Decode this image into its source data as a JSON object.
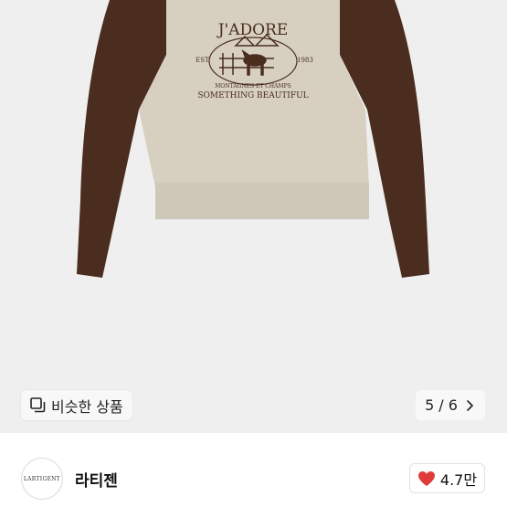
{
  "product": {
    "print_title": "J'ADORE",
    "print_left": "EST.",
    "print_right": "1983",
    "print_sub1": "MONTAGNES ET CHAMPS",
    "print_sub2": "SOMETHING BEAUTIFUL"
  },
  "gallery": {
    "similar_label": "비슷한 상품",
    "current_page": "5",
    "separator": "/",
    "total_pages": "6"
  },
  "seller": {
    "avatar_text": "LARTIGENT",
    "name": "라티젠"
  },
  "likes": {
    "count": "4.7만"
  },
  "colors": {
    "sleeve": "#4a2d1f",
    "body": "#d7d0c1",
    "heart": "#e03c3c"
  }
}
